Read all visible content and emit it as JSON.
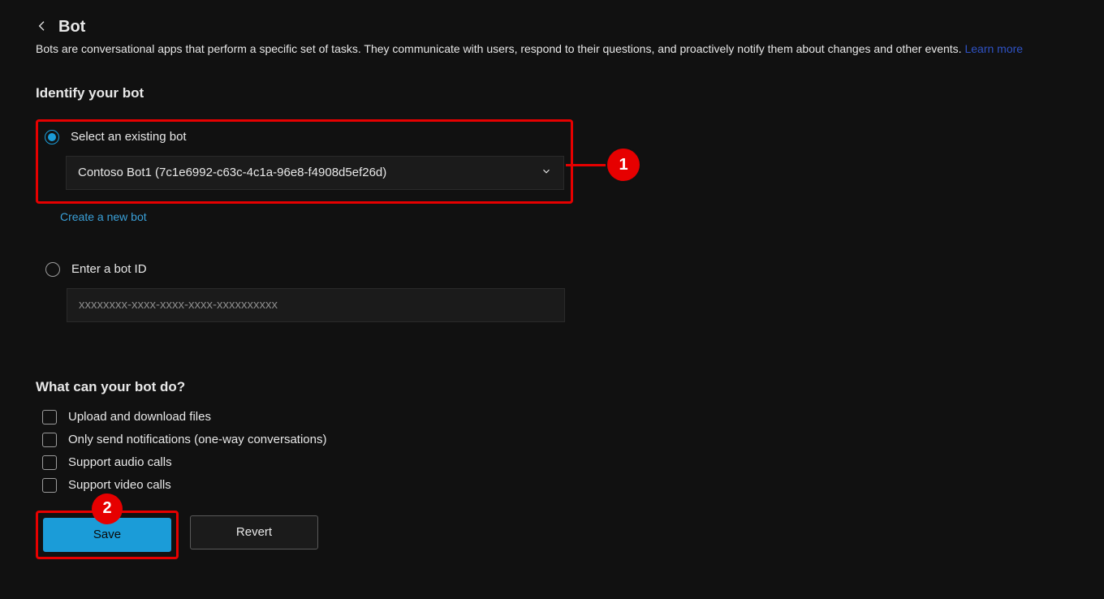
{
  "header": {
    "title": "Bot",
    "subtitle": "Bots are conversational apps that perform a specific set of tasks. They communicate with users, respond to their questions, and proactively notify them about changes and other events.",
    "learn_more": "Learn more"
  },
  "identify": {
    "heading": "Identify your bot",
    "option_existing_label": "Select an existing bot",
    "dropdown_value": "Contoso Bot1 (7c1e6992-c63c-4c1a-96e8-f4908d5ef26d)",
    "create_link": "Create a new bot",
    "option_enter_id_label": "Enter a bot ID",
    "id_placeholder": "xxxxxxxx-xxxx-xxxx-xxxx-xxxxxxxxxx"
  },
  "capabilities": {
    "heading": "What can your bot do?",
    "items": [
      "Upload and download files",
      "Only send notifications (one-way conversations)",
      "Support audio calls",
      "Support video calls"
    ]
  },
  "buttons": {
    "save": "Save",
    "revert": "Revert"
  },
  "callouts": {
    "pin1": "1",
    "pin2": "2"
  }
}
